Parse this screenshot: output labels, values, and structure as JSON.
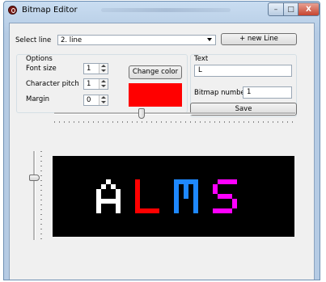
{
  "window": {
    "title": "Bitmap Editor",
    "minimize_symbol": "–",
    "maximize_symbol": "□",
    "close_symbol": "X"
  },
  "select_line": {
    "label": "Select line",
    "value": "2. line",
    "new_line_button": "+ new Line"
  },
  "options": {
    "group_label": "Options",
    "font_size_label": "Font size",
    "font_size_value": "1",
    "character_pitch_label": "Character pitch",
    "character_pitch_value": "1",
    "margin_label": "Margin",
    "margin_value": "0",
    "change_color_button": "Change color",
    "current_color": "#ff0000"
  },
  "text_panel": {
    "group_label": "Text",
    "text_value": "L",
    "bitmap_number_label": "Bitmap number",
    "bitmap_number_value": "1",
    "save_button": "Save"
  },
  "preview": {
    "background": "#000000",
    "characters": [
      {
        "char": "A",
        "color": "#ffffff"
      },
      {
        "char": "L",
        "color": "#ff0000"
      },
      {
        "char": "M",
        "color": "#1e88ff"
      },
      {
        "char": "S",
        "color": "#ff00ff"
      }
    ]
  }
}
